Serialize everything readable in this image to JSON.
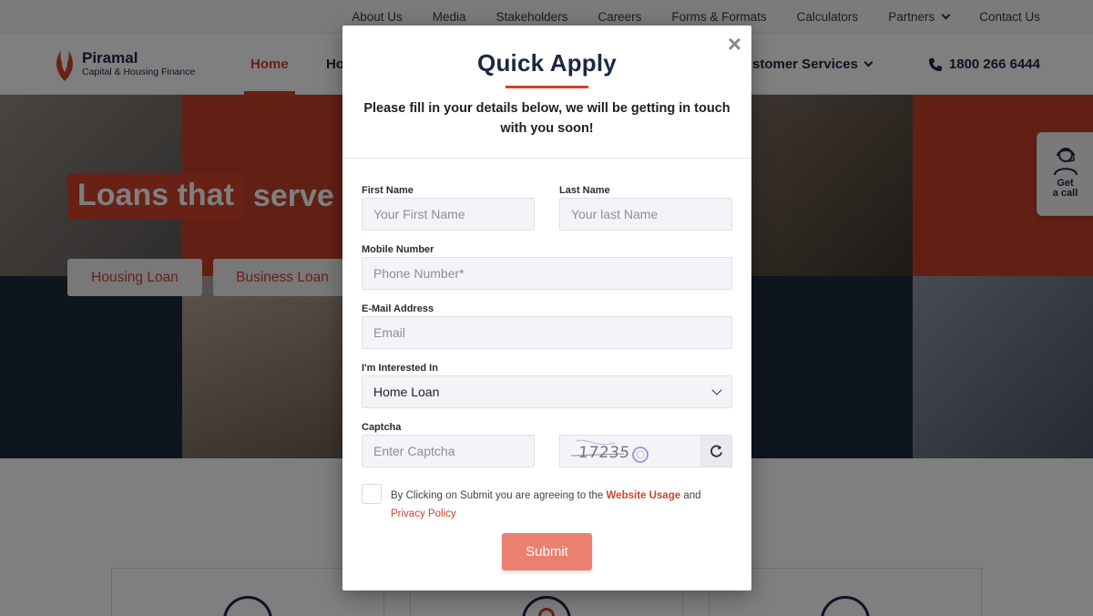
{
  "topbar": {
    "links": [
      "About Us",
      "Media",
      "Stakeholders",
      "Careers",
      "Forms & Formats",
      "Calculators",
      "Partners",
      "Contact Us"
    ]
  },
  "brand": {
    "name": "Piramal",
    "tagline": "Capital & Housing Finance"
  },
  "nav": {
    "home": "Home",
    "home_loans_partial": "Ho",
    "customer_services_partial": "stomer Services",
    "phone": "1800 266 6444"
  },
  "hero": {
    "title_highlight": "Loans that",
    "title_rest": "serve",
    "buttons": [
      "Housing Loan",
      "Business Loan"
    ]
  },
  "side_widget": {
    "line1": "Get",
    "line2": "a call"
  },
  "modal": {
    "title": "Quick Apply",
    "subtitle": "Please fill in your details below, we will be getting in touch with you soon!",
    "close": "×",
    "first_name": {
      "label": "First Name",
      "placeholder": "Your First Name"
    },
    "last_name": {
      "label": "Last Name",
      "placeholder": "Your last Name"
    },
    "mobile": {
      "label": "Mobile Number",
      "placeholder": "Phone Number*"
    },
    "email": {
      "label": "E-Mail Address",
      "placeholder": "Email"
    },
    "interest": {
      "label": "I'm Interested In",
      "value": "Home Loan"
    },
    "captcha": {
      "label": "Captcha",
      "placeholder": "Enter Captcha",
      "code": "17235"
    },
    "terms": {
      "prefix": "By Clicking on Submit you are agreeing to the ",
      "link1": "Website Usage",
      "middle": " and",
      "link2": "Privacy Policy"
    },
    "submit": "Submit"
  },
  "colors": {
    "brand_red": "#d2412b",
    "navy": "#1d2744",
    "submit_bg": "#ec8070"
  }
}
